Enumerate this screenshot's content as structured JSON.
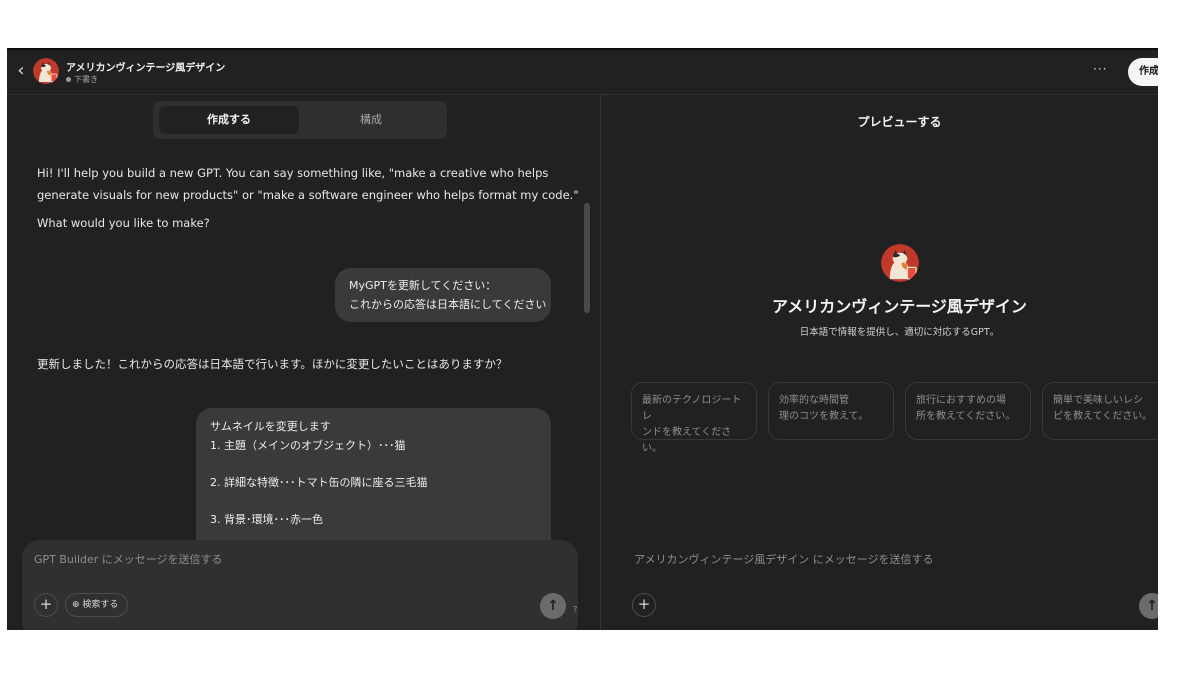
{
  "header": {
    "back_icon": "chevron-left-icon",
    "title": "アメリカンヴィンテージ風デザイン",
    "status": "下書き",
    "more_label": "···",
    "create_label": "作成"
  },
  "builder": {
    "tabs": [
      {
        "label": "作成する",
        "active": true
      },
      {
        "label": "構成",
        "active": false
      }
    ],
    "messages": {
      "assistant_intro_line1": "Hi! I'll help you build a new GPT. You can say something like, \"make a creative who helps",
      "assistant_intro_line2": "generate visuals for new products\" or \"make a software engineer who helps format my code.\"",
      "assistant_intro_line3": "What would you like to make?",
      "user_1_line1": "MyGPTを更新してください：",
      "user_1_line2": "これからの応答は日本語にしてください",
      "assistant_reply": "更新しました！これからの応答は日本語で行います。ほかに変更したいことはありますか？",
      "user_2_line1": "サムネイルを変更します",
      "user_2_line2": "1. 主題（メインのオブジェクト）･･･猫",
      "user_2_line3": "2. 詳細な特徴･･･トマト缶の隣に座る三毛猫",
      "user_2_line4": "3. 背景･環境･･･赤一色"
    },
    "composer": {
      "placeholder": "GPT Builder にメッセージを送信する",
      "plus_label": "+",
      "search_label": "検索する",
      "send_label": "↑",
      "help_label": "?"
    }
  },
  "preview": {
    "title": "プレビューする",
    "gpt_name": "アメリカンヴィンテージ風デザイン",
    "gpt_description": "日本語で情報を提供し、適切に対応するGPT。",
    "starters": [
      {
        "line1": "最新のテクノロジートレ",
        "line2": "ンドを教えてください。"
      },
      {
        "line1": "効率的な時間管",
        "line2": "理のコツを教えて。"
      },
      {
        "line1": "旅行におすすめの場",
        "line2": "所を教えてください。"
      },
      {
        "line1": "簡単で美味しいレシ",
        "line2": "ピを教えてください。"
      }
    ],
    "composer": {
      "placeholder": "アメリカンヴィンテージ風デザイン にメッセージを送信する",
      "plus_label": "+",
      "send_label": "↑"
    }
  },
  "colors": {
    "background": "#212121",
    "bubble": "#3a3a3a",
    "composer": "#303030",
    "avatar_red": "#c0392b"
  }
}
